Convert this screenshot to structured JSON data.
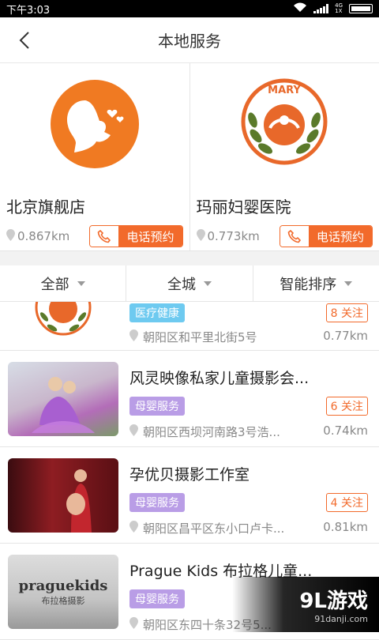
{
  "status": {
    "time": "下午3:03",
    "net": "4G\n1X"
  },
  "header": {
    "title": "本地服务"
  },
  "stores": [
    {
      "name": "北京旗舰店",
      "distance": "0.867km",
      "call_label": "电话预约",
      "logo": "mother-baby-logo"
    },
    {
      "name": "玛丽妇婴医院",
      "distance": "0.773km",
      "call_label": "电话预约",
      "logo": "mary-logo",
      "logo_text": "MARY"
    }
  ],
  "filters": [
    {
      "label": "全部"
    },
    {
      "label": "全城"
    },
    {
      "label": "智能排序"
    }
  ],
  "items": [
    {
      "name": "",
      "tag": "医疗健康",
      "follow": "8 关注",
      "address": "朝阳区和平里北街5号",
      "distance": "0.77km"
    },
    {
      "name": "风灵映像私家儿童摄影会...",
      "tag": "母婴服务",
      "follow": "6 关注",
      "address": "朝阳区西坝河南路3号浩...",
      "distance": "0.74km"
    },
    {
      "name": "孕优贝摄影工作室",
      "tag": "母婴服务",
      "follow": "4 关注",
      "address": "朝阳区昌平区东小口卢卡...",
      "distance": "0.81km"
    },
    {
      "name": "Prague Kids 布拉格儿童...",
      "tag": "母婴服务",
      "follow": "",
      "address": "朝阳区东四十条32号5...",
      "distance": ""
    }
  ],
  "thumb_texts": {
    "prague_main": "praguekids",
    "prague_sub": "布拉格摄影"
  },
  "watermark": {
    "main": "9L游戏",
    "sub": "91danji.com"
  },
  "colors": {
    "accent": "#f26a2b",
    "health_tag": "#6ecaf0",
    "baby_tag": "#b99de6"
  }
}
